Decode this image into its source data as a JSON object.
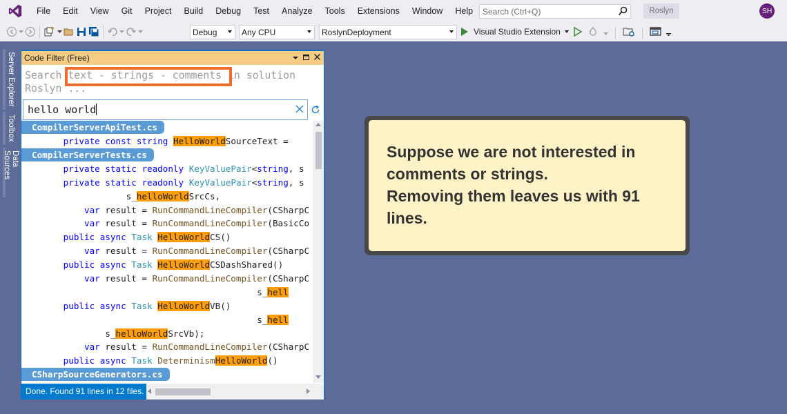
{
  "menubar": {
    "items": [
      "File",
      "Edit",
      "View",
      "Git",
      "Project",
      "Build",
      "Debug",
      "Test",
      "Analyze",
      "Tools",
      "Extensions",
      "Window",
      "Help"
    ],
    "search_placeholder": "Search (Ctrl+Q)",
    "solution_name": "Roslyn",
    "user_initials": "SH"
  },
  "toolbar": {
    "configuration": "Debug",
    "platform": "Any CPU",
    "startup_project": "RoslynDeployment",
    "run_label": "Visual Studio Extension"
  },
  "side_tabs": [
    "Server Explorer",
    "Toolbox",
    "Data Sources"
  ],
  "code_filter": {
    "title": "Code Filter (Free)",
    "hint_line1": "Search text - strings - comments in solution",
    "hint_line2": "Roslyn ...",
    "query": "hello world",
    "status": "Done. Found 91 lines in 12 files."
  },
  "results": {
    "file1": "CompilerServerApiTest.cs",
    "l1_pre": "        private const string ",
    "l1_hl": "HelloWorld",
    "l1_post": "SourceText =",
    "file2": "CompilerServerTests.cs",
    "l2": "        private static readonly KeyValuePair<string, s",
    "l3": "        private static readonly KeyValuePair<string, s",
    "l4_pre": "                    s_",
    "l4_hl": "helloWorld",
    "l4_post": "SrcCs,",
    "l5": "            var result = RunCommandLineCompiler(CSharpC",
    "l6": "            var result = RunCommandLineCompiler(BasicCo",
    "l7_pre": "        public async Task ",
    "l7_hl": "HelloWorld",
    "l7_post": "CS()",
    "l8": "            var result = RunCommandLineCompiler(CSharpC",
    "l9_pre": "        public async Task ",
    "l9_hl": "HelloWorld",
    "l9_post": "CSDashShared()",
    "l10": "            var result = RunCommandLineCompiler(CSharpC",
    "l11_pre": "                                             s_",
    "l11_hl": "hell",
    "l12_pre": "        public async Task ",
    "l12_hl": "HelloWorld",
    "l12_post": "VB()",
    "l13_pre": "                                             s_",
    "l13_hl": "hell",
    "l14_pre": "                s_",
    "l14_hl": "helloWorld",
    "l14_post": "SrcVb);",
    "l15": "            var result = RunCommandLineCompiler(CSharpC",
    "l16_pre": "        public async Task Determinism",
    "l16_hl": "HelloWorld",
    "l16_post": "()",
    "file3": "CSharpSourceGenerators.cs"
  },
  "callout": {
    "line1": "Suppose we are not interested in",
    "line2": "comments or strings.",
    "line3": "Removing them leaves us with 91",
    "line4": "lines."
  },
  "colors": {
    "background": "#5d6b99",
    "highlight": "#ff9d0a",
    "file_tab": "#5b9bd5",
    "hint_box": "#ef6c2c",
    "callout_bg": "#fff2c6"
  }
}
